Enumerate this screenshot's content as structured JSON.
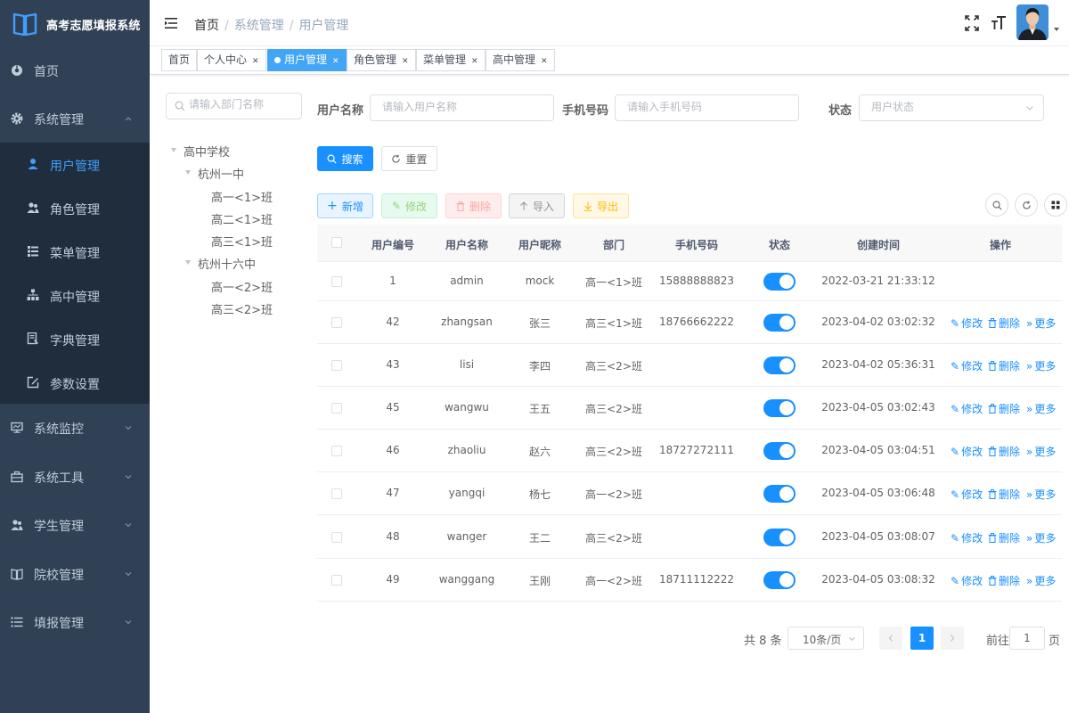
{
  "app": {
    "title": "高考志愿填报系统"
  },
  "sidebar": {
    "items": [
      {
        "label": "首页",
        "icon": "dashboard-icon"
      },
      {
        "label": "系统管理",
        "icon": "gear-icon",
        "expanded": true,
        "children": [
          {
            "label": "用户管理",
            "icon": "user-icon",
            "active": true
          },
          {
            "label": "角色管理",
            "icon": "peoples-icon"
          },
          {
            "label": "菜单管理",
            "icon": "tree-table-icon"
          },
          {
            "label": "高中管理",
            "icon": "org-tree-icon"
          },
          {
            "label": "字典管理",
            "icon": "dict-icon"
          },
          {
            "label": "参数设置",
            "icon": "edit-icon"
          }
        ]
      },
      {
        "label": "系统监控",
        "icon": "monitor-icon"
      },
      {
        "label": "系统工具",
        "icon": "tool-icon"
      },
      {
        "label": "学生管理",
        "icon": "student-icon"
      },
      {
        "label": "院校管理",
        "icon": "book-icon"
      },
      {
        "label": "填报管理",
        "icon": "list-icon"
      }
    ]
  },
  "header": {
    "breadcrumb": [
      "首页",
      "系统管理",
      "用户管理"
    ]
  },
  "tags": [
    {
      "label": "首页",
      "closable": false,
      "active": false
    },
    {
      "label": "个人中心",
      "closable": true,
      "active": false
    },
    {
      "label": "用户管理",
      "closable": true,
      "active": true
    },
    {
      "label": "角色管理",
      "closable": true,
      "active": false
    },
    {
      "label": "菜单管理",
      "closable": true,
      "active": false
    },
    {
      "label": "高中管理",
      "closable": true,
      "active": false
    }
  ],
  "dept": {
    "search_placeholder": "请输入部门名称",
    "tree": [
      {
        "label": "高中学校",
        "level": 0,
        "expanded": true
      },
      {
        "label": "杭州一中",
        "level": 1,
        "expanded": true
      },
      {
        "label": "高一<1>班",
        "level": 2
      },
      {
        "label": "高二<1>班",
        "level": 2
      },
      {
        "label": "高三<1>班",
        "level": 2
      },
      {
        "label": "杭州十六中",
        "level": 1,
        "expanded": true
      },
      {
        "label": "高一<2>班",
        "level": 2
      },
      {
        "label": "高三<2>班",
        "level": 2
      }
    ]
  },
  "filters": {
    "username": {
      "label": "用户名称",
      "placeholder": "请输入用户名称",
      "value": ""
    },
    "phone": {
      "label": "手机号码",
      "placeholder": "请输入手机号码",
      "value": ""
    },
    "status": {
      "label": "状态",
      "placeholder": "用户状态",
      "value": ""
    },
    "search_label": "搜索",
    "reset_label": "重置"
  },
  "toolbar": {
    "add": "新增",
    "edit": "修改",
    "delete": "删除",
    "import": "导入",
    "export": "导出"
  },
  "table": {
    "columns": [
      "用户编号",
      "用户名称",
      "用户昵称",
      "部门",
      "手机号码",
      "状态",
      "创建时间",
      "操作"
    ],
    "rows": [
      {
        "id": "1",
        "username": "admin",
        "nickname": "mock",
        "dept": "高一<1>班",
        "phone": "15888888823",
        "enabled": true,
        "created": "2022-03-21 21:33:12",
        "actions": false
      },
      {
        "id": "42",
        "username": "zhangsan",
        "nickname": "张三",
        "dept": "高三<1>班",
        "phone": "18766662222",
        "enabled": true,
        "created": "2023-04-02 03:02:32",
        "actions": true
      },
      {
        "id": "43",
        "username": "lisi",
        "nickname": "李四",
        "dept": "高三<2>班",
        "phone": "",
        "enabled": true,
        "created": "2023-04-02 05:36:31",
        "actions": true
      },
      {
        "id": "45",
        "username": "wangwu",
        "nickname": "王五",
        "dept": "高三<2>班",
        "phone": "",
        "enabled": true,
        "created": "2023-04-05 03:02:43",
        "actions": true
      },
      {
        "id": "46",
        "username": "zhaoliu",
        "nickname": "赵六",
        "dept": "高三<2>班",
        "phone": "18727272111",
        "enabled": true,
        "created": "2023-04-05 03:04:51",
        "actions": true
      },
      {
        "id": "47",
        "username": "yangqi",
        "nickname": "杨七",
        "dept": "高一<2>班",
        "phone": "",
        "enabled": true,
        "created": "2023-04-05 03:06:48",
        "actions": true
      },
      {
        "id": "48",
        "username": "wanger",
        "nickname": "王二",
        "dept": "高三<2>班",
        "phone": "",
        "enabled": true,
        "created": "2023-04-05 03:08:07",
        "actions": true
      },
      {
        "id": "49",
        "username": "wanggang",
        "nickname": "王刚",
        "dept": "高一<2>班",
        "phone": "18711112222",
        "enabled": true,
        "created": "2023-04-05 03:08:32",
        "actions": true
      }
    ],
    "row_actions": {
      "edit": "修改",
      "delete": "删除",
      "more": "更多"
    }
  },
  "pagination": {
    "total_text": "共 8 条",
    "page_size": "10条/页",
    "current_page": "1",
    "goto_prefix": "前往",
    "goto_value": "1",
    "goto_suffix": "页"
  },
  "colors": {
    "sidebar_bg": "#304156",
    "sidebar_active_bg": "#1f2d3d",
    "accent": "#1890ff",
    "active_menu_text": "#409eff",
    "active_tag": "#42a5f5"
  }
}
